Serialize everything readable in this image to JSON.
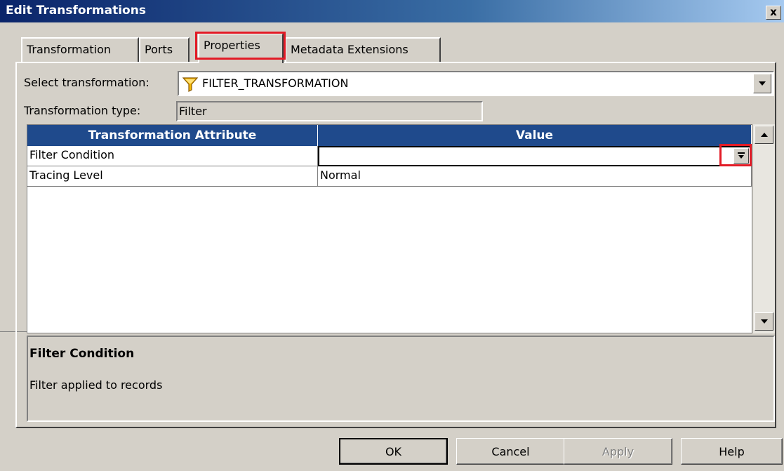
{
  "window": {
    "title": "Edit Transformations",
    "close_glyph": "x",
    "close_icon": "close-icon"
  },
  "tabs": [
    {
      "label": "Transformation"
    },
    {
      "label": "Ports"
    },
    {
      "label": "Properties",
      "active": true
    },
    {
      "label": "Metadata Extensions"
    }
  ],
  "form": {
    "select_label": "Select transformation:",
    "select_value": "FILTER_TRANSFORMATION",
    "select_icon": "funnel-icon",
    "type_label": "Transformation type:",
    "type_value": "Filter"
  },
  "grid": {
    "headers": [
      "Transformation Attribute",
      "Value"
    ],
    "rows": [
      {
        "attribute": "Filter Condition",
        "value": ""
      },
      {
        "attribute": "Tracing Level",
        "value": "Normal"
      }
    ]
  },
  "description": {
    "title": "Filter Condition",
    "text": "Filter applied to records"
  },
  "buttons": {
    "ok": "OK",
    "cancel": "Cancel",
    "apply": "Apply",
    "help": "Help"
  },
  "colors": {
    "highlight": "#e21b26",
    "grid_header": "#1f4a8c",
    "titlebar": "#0a246a"
  }
}
